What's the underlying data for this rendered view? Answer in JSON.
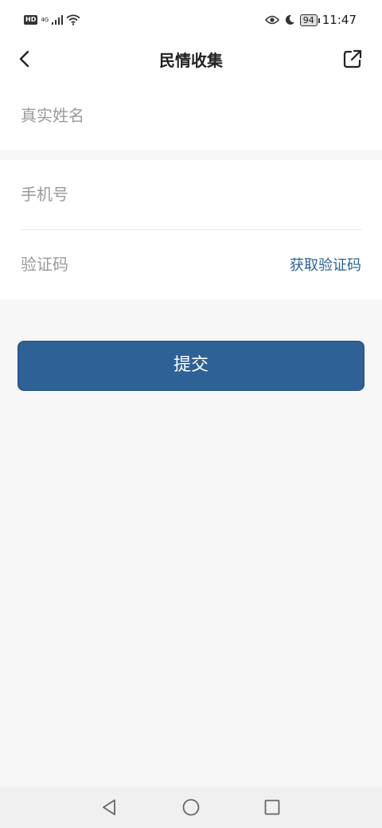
{
  "status_bar": {
    "hd": "HD",
    "network": "4G",
    "battery": "94",
    "time": "11:47"
  },
  "header": {
    "title": "民情收集"
  },
  "form": {
    "name_placeholder": "真实姓名",
    "phone_placeholder": "手机号",
    "code_placeholder": "验证码",
    "get_code_label": "获取验证码"
  },
  "submit_label": "提交",
  "colors": {
    "primary": "#2e6196",
    "link": "#2b6299",
    "background": "#f7f7f7"
  },
  "icons": {
    "back": "chevron-left-icon",
    "share": "share-external-icon",
    "nav_back": "triangle-back-icon",
    "nav_home": "circle-home-icon",
    "nav_recent": "square-recent-icon"
  }
}
